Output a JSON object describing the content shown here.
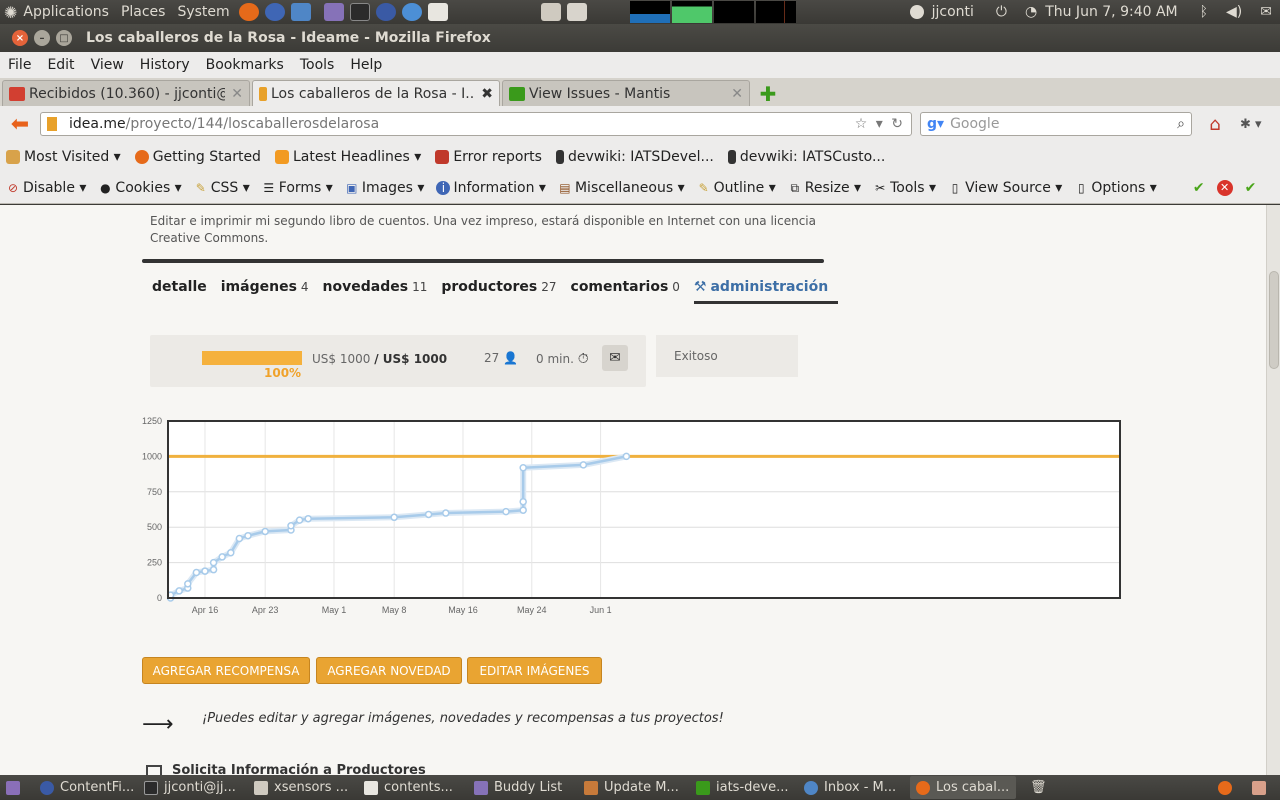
{
  "top_panel": {
    "menus": [
      "Applications",
      "Places",
      "System"
    ],
    "user": "jjconti",
    "datetime": "Thu Jun  7,  9:40 AM"
  },
  "window": {
    "title": "Los caballeros de la Rosa - Ideame - Mozilla Firefox"
  },
  "menubar": [
    "File",
    "Edit",
    "View",
    "History",
    "Bookmarks",
    "Tools",
    "Help"
  ],
  "tabs": [
    {
      "label": "Recibidos (10.360) - jjconti@...",
      "color": "#d23f31"
    },
    {
      "label": "Los caballeros de la Rosa - I...",
      "color": "#e8a12a"
    },
    {
      "label": "View Issues - Mantis",
      "color": "#3a9a1b"
    }
  ],
  "urlbar": {
    "host": "idea.me",
    "path": "/proyecto/144/loscaballerosdelarosa"
  },
  "search": {
    "placeholder": "Google"
  },
  "bookmarks": [
    "Most Visited",
    "Getting Started",
    "Latest Headlines",
    "Error reports",
    "devwiki: IATSDevel...",
    "devwiki: IATSCusto..."
  ],
  "devtoolbar": [
    "Disable",
    "Cookies",
    "CSS",
    "Forms",
    "Images",
    "Information",
    "Miscellaneous",
    "Outline",
    "Resize",
    "Tools",
    "View Source",
    "Options"
  ],
  "page": {
    "description": "Editar e imprimir mi segundo libro de cuentos. Una vez impreso, estará disponible en Internet con una licencia Creative Commons.",
    "nav": [
      {
        "label": "detalle",
        "count": ""
      },
      {
        "label": "imágenes",
        "count": "4"
      },
      {
        "label": "novedades",
        "count": "11"
      },
      {
        "label": "productores",
        "count": "27"
      },
      {
        "label": "comentarios",
        "count": "0"
      }
    ],
    "admin_label": "administración",
    "stats": {
      "progress": 1.0,
      "percent": "100%",
      "raised": "US$ 1000",
      "goal": "/ US$ 1000",
      "backers": "27",
      "time_left": "0 min."
    },
    "status": "Exitoso",
    "buttons": [
      "Agregar recompensa",
      "Agregar novedad",
      "Editar imágenes"
    ],
    "hint": "¡Puedes editar y agregar imágenes, novedades y recompensas a tus proyectos!",
    "section_title": "Solicita Información a Productores"
  },
  "chart_data": {
    "type": "line",
    "x_ticks": [
      "Apr 16",
      "Apr 23",
      "May 1",
      "May 8",
      "May 16",
      "May 24",
      "Jun 1"
    ],
    "ylim": [
      0,
      1250
    ],
    "y_ticks": [
      0,
      250,
      500,
      750,
      1000,
      1250
    ],
    "goal": 1000,
    "colors": {
      "line": "#a8cbea",
      "goal": "#f0b13e"
    },
    "series": [
      {
        "points": [
          [
            "2012-04-12",
            0
          ],
          [
            "2012-04-12",
            20
          ],
          [
            "2012-04-13",
            50
          ],
          [
            "2012-04-14",
            70
          ],
          [
            "2012-04-14",
            100
          ],
          [
            "2012-04-15",
            180
          ],
          [
            "2012-04-16",
            190
          ],
          [
            "2012-04-16",
            190
          ],
          [
            "2012-04-17",
            200
          ],
          [
            "2012-04-17",
            250
          ],
          [
            "2012-04-18",
            290
          ],
          [
            "2012-04-19",
            320
          ],
          [
            "2012-04-20",
            420
          ],
          [
            "2012-04-21",
            440
          ],
          [
            "2012-04-23",
            470
          ],
          [
            "2012-04-26",
            480
          ],
          [
            "2012-04-26",
            510
          ],
          [
            "2012-04-27",
            550
          ],
          [
            "2012-04-28",
            560
          ],
          [
            "2012-05-08",
            570
          ],
          [
            "2012-05-12",
            590
          ],
          [
            "2012-05-14",
            600
          ],
          [
            "2012-05-21",
            610
          ],
          [
            "2012-05-23",
            620
          ],
          [
            "2012-05-23",
            680
          ],
          [
            "2012-05-23",
            920
          ],
          [
            "2012-05-30",
            940
          ],
          [
            "2012-06-04",
            1000
          ]
        ]
      }
    ]
  },
  "taskbar": [
    "ContentFi...",
    "jjconti@jj...",
    "xsensors ...",
    "contents...",
    "Buddy List",
    "Update M...",
    "iats-deve...",
    "Inbox - M...",
    "Los cabal..."
  ]
}
